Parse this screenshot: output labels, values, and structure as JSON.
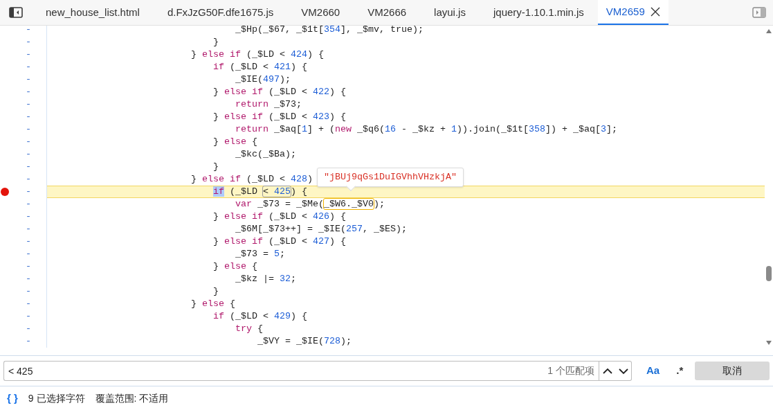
{
  "tabs": [
    {
      "label": "new_house_list.html",
      "selected": false
    },
    {
      "label": "d.FxJzG50F.dfe1675.js",
      "selected": false
    },
    {
      "label": "VM2660",
      "selected": false
    },
    {
      "label": "VM2666",
      "selected": false
    },
    {
      "label": "layui.js",
      "selected": false
    },
    {
      "label": "jquery-1.10.1.min.js",
      "selected": false
    },
    {
      "label": "VM2659",
      "selected": true
    }
  ],
  "code": {
    "lines": [
      {
        "gutter": "-",
        "breakpoint": false,
        "paused": false,
        "segments": [
          {
            "text": "                                  _$Hp(_$67, _$1t[",
            "kind": "plain"
          },
          {
            "text": "354",
            "kind": "number"
          },
          {
            "text": "], _$mv, true);",
            "kind": "plain"
          }
        ]
      },
      {
        "gutter": "-",
        "breakpoint": false,
        "paused": false,
        "segments": [
          {
            "text": "                              }",
            "kind": "plain"
          }
        ]
      },
      {
        "gutter": "-",
        "breakpoint": false,
        "paused": false,
        "segments": [
          {
            "text": "                          } ",
            "kind": "plain"
          },
          {
            "text": "else if",
            "kind": "keyword"
          },
          {
            "text": " (_$LD < ",
            "kind": "plain"
          },
          {
            "text": "424",
            "kind": "number"
          },
          {
            "text": ") {",
            "kind": "plain"
          }
        ]
      },
      {
        "gutter": "-",
        "breakpoint": false,
        "paused": false,
        "segments": [
          {
            "text": "                              if",
            "kind": "keyword"
          },
          {
            "text": " (_$LD < ",
            "kind": "plain"
          },
          {
            "text": "421",
            "kind": "number"
          },
          {
            "text": ") {",
            "kind": "plain"
          }
        ]
      },
      {
        "gutter": "-",
        "breakpoint": false,
        "paused": false,
        "segments": [
          {
            "text": "                                  _$IE(",
            "kind": "plain"
          },
          {
            "text": "497",
            "kind": "number"
          },
          {
            "text": ");",
            "kind": "plain"
          }
        ]
      },
      {
        "gutter": "-",
        "breakpoint": false,
        "paused": false,
        "segments": [
          {
            "text": "                              } ",
            "kind": "plain"
          },
          {
            "text": "else if",
            "kind": "keyword"
          },
          {
            "text": " (_$LD < ",
            "kind": "plain"
          },
          {
            "text": "422",
            "kind": "number"
          },
          {
            "text": ") {",
            "kind": "plain"
          }
        ]
      },
      {
        "gutter": "-",
        "breakpoint": false,
        "paused": false,
        "segments": [
          {
            "text": "                                  return",
            "kind": "keyword"
          },
          {
            "text": " _$73;",
            "kind": "plain"
          }
        ]
      },
      {
        "gutter": "-",
        "breakpoint": false,
        "paused": false,
        "segments": [
          {
            "text": "                              } ",
            "kind": "plain"
          },
          {
            "text": "else if",
            "kind": "keyword"
          },
          {
            "text": " (_$LD < ",
            "kind": "plain"
          },
          {
            "text": "423",
            "kind": "number"
          },
          {
            "text": ") {",
            "kind": "plain"
          }
        ]
      },
      {
        "gutter": "-",
        "breakpoint": false,
        "paused": false,
        "segments": [
          {
            "text": "                                  return",
            "kind": "keyword"
          },
          {
            "text": " _$aq[",
            "kind": "plain"
          },
          {
            "text": "1",
            "kind": "number"
          },
          {
            "text": "] + (",
            "kind": "plain"
          },
          {
            "text": "new",
            "kind": "keyword"
          },
          {
            "text": " _$q6(",
            "kind": "plain"
          },
          {
            "text": "16",
            "kind": "number"
          },
          {
            "text": " - _$kz + ",
            "kind": "plain"
          },
          {
            "text": "1",
            "kind": "number"
          },
          {
            "text": ")).join(_$1t[",
            "kind": "plain"
          },
          {
            "text": "358",
            "kind": "number"
          },
          {
            "text": "]) + _$aq[",
            "kind": "plain"
          },
          {
            "text": "3",
            "kind": "number"
          },
          {
            "text": "];",
            "kind": "plain"
          }
        ]
      },
      {
        "gutter": "-",
        "breakpoint": false,
        "paused": false,
        "segments": [
          {
            "text": "                              } ",
            "kind": "plain"
          },
          {
            "text": "else",
            "kind": "keyword"
          },
          {
            "text": " {",
            "kind": "plain"
          }
        ]
      },
      {
        "gutter": "-",
        "breakpoint": false,
        "paused": false,
        "segments": [
          {
            "text": "                                  _$kc(_$Ba);",
            "kind": "plain"
          }
        ]
      },
      {
        "gutter": "-",
        "breakpoint": false,
        "paused": false,
        "segments": [
          {
            "text": "                              }",
            "kind": "plain"
          }
        ]
      },
      {
        "gutter": "-",
        "breakpoint": false,
        "paused": false,
        "segments": [
          {
            "text": "                          } ",
            "kind": "plain"
          },
          {
            "text": "else if",
            "kind": "keyword"
          },
          {
            "text": " (_$LD < ",
            "kind": "plain"
          },
          {
            "text": "428",
            "kind": "number"
          },
          {
            "text": ")",
            "kind": "plain"
          }
        ]
      },
      {
        "gutter": "-",
        "breakpoint": true,
        "paused": true,
        "segments": [
          {
            "text": "                              if",
            "kind": "selection"
          },
          {
            "text": " (_$LD ",
            "kind": "plain"
          },
          {
            "kind": "search_match",
            "segments": [
              {
                "text": "< ",
                "kind": "plain"
              },
              {
                "text": "425",
                "kind": "number"
              }
            ]
          },
          {
            "text": ") {",
            "kind": "plain"
          }
        ]
      },
      {
        "gutter": "-",
        "breakpoint": false,
        "paused": false,
        "segments": [
          {
            "text": "                                  var",
            "kind": "keyword"
          },
          {
            "text": " _$73 = _$Me(",
            "kind": "plain"
          },
          {
            "text": "_$W6._$V0",
            "kind": "hovered"
          },
          {
            "text": ");",
            "kind": "plain"
          }
        ]
      },
      {
        "gutter": "-",
        "breakpoint": false,
        "paused": false,
        "segments": [
          {
            "text": "                              } ",
            "kind": "plain"
          },
          {
            "text": "else if",
            "kind": "keyword"
          },
          {
            "text": " (_$LD < ",
            "kind": "plain"
          },
          {
            "text": "426",
            "kind": "number"
          },
          {
            "text": ") {",
            "kind": "plain"
          }
        ]
      },
      {
        "gutter": "-",
        "breakpoint": false,
        "paused": false,
        "segments": [
          {
            "text": "                                  _$6M[_$73++] = _$IE(",
            "kind": "plain"
          },
          {
            "text": "257",
            "kind": "number"
          },
          {
            "text": ", _$ES);",
            "kind": "plain"
          }
        ]
      },
      {
        "gutter": "-",
        "breakpoint": false,
        "paused": false,
        "segments": [
          {
            "text": "                              } ",
            "kind": "plain"
          },
          {
            "text": "else if",
            "kind": "keyword"
          },
          {
            "text": " (_$LD < ",
            "kind": "plain"
          },
          {
            "text": "427",
            "kind": "number"
          },
          {
            "text": ") {",
            "kind": "plain"
          }
        ]
      },
      {
        "gutter": "-",
        "breakpoint": false,
        "paused": false,
        "segments": [
          {
            "text": "                                  _$73 = ",
            "kind": "plain"
          },
          {
            "text": "5",
            "kind": "number"
          },
          {
            "text": ";",
            "kind": "plain"
          }
        ]
      },
      {
        "gutter": "-",
        "breakpoint": false,
        "paused": false,
        "segments": [
          {
            "text": "                              } ",
            "kind": "plain"
          },
          {
            "text": "else",
            "kind": "keyword"
          },
          {
            "text": " {",
            "kind": "plain"
          }
        ]
      },
      {
        "gutter": "-",
        "breakpoint": false,
        "paused": false,
        "segments": [
          {
            "text": "                                  _$kz |= ",
            "kind": "plain"
          },
          {
            "text": "32",
            "kind": "number"
          },
          {
            "text": ";",
            "kind": "plain"
          }
        ]
      },
      {
        "gutter": "-",
        "breakpoint": false,
        "paused": false,
        "segments": [
          {
            "text": "                              }",
            "kind": "plain"
          }
        ]
      },
      {
        "gutter": "-",
        "breakpoint": false,
        "paused": false,
        "segments": [
          {
            "text": "                          } ",
            "kind": "plain"
          },
          {
            "text": "else",
            "kind": "keyword"
          },
          {
            "text": " {",
            "kind": "plain"
          }
        ]
      },
      {
        "gutter": "-",
        "breakpoint": false,
        "paused": false,
        "segments": [
          {
            "text": "                              if",
            "kind": "keyword"
          },
          {
            "text": " (_$LD < ",
            "kind": "plain"
          },
          {
            "text": "429",
            "kind": "number"
          },
          {
            "text": ") {",
            "kind": "plain"
          }
        ]
      },
      {
        "gutter": "-",
        "breakpoint": false,
        "paused": false,
        "segments": [
          {
            "text": "                                  try",
            "kind": "keyword"
          },
          {
            "text": " {",
            "kind": "plain"
          }
        ]
      },
      {
        "gutter": "-",
        "breakpoint": false,
        "paused": false,
        "segments": [
          {
            "text": "                                      _$VY = _$IE(",
            "kind": "plain"
          },
          {
            "text": "728",
            "kind": "number"
          },
          {
            "text": ");",
            "kind": "plain"
          }
        ]
      }
    ],
    "tooltip": {
      "text": "\"jBUj9qGs1DuIGVhhVHzkjA\""
    }
  },
  "search": {
    "value": "< 425",
    "match_count": "1 个匹配项",
    "match_case": {
      "label": "Aa",
      "on": true
    },
    "regex": {
      "label": ".*",
      "on": false
    },
    "cancel": "取消"
  },
  "status_bar": {
    "format_label": "{ }",
    "selection": "9 已选择字符",
    "coverage": "覆盖范围: 不适用"
  }
}
